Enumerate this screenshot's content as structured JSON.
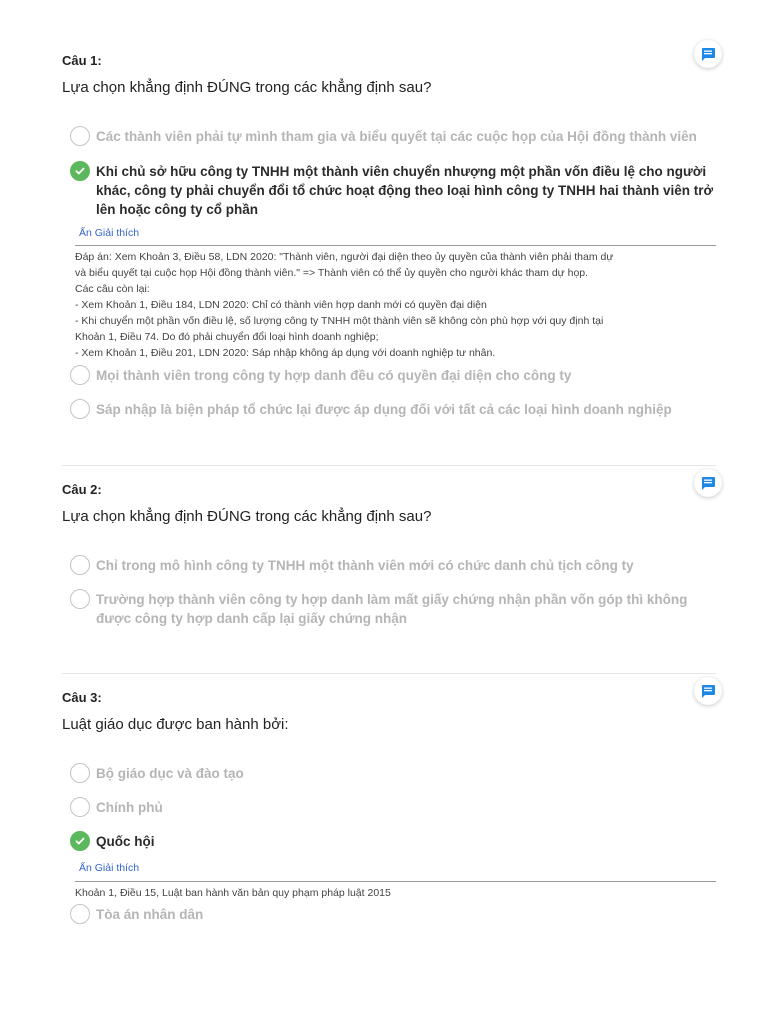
{
  "questions": [
    {
      "label": "Câu 1:",
      "title": "Lựa chọn khẳng định ĐÚNG trong các khẳng định sau?",
      "options": [
        {
          "text": "Các thành viên phải tự mình tham gia và biểu quyết tại các cuộc họp của Hội đồng thành viên",
          "checked": false
        },
        {
          "text": "Khi chủ sở hữu công ty TNHH một thành viên chuyển nhượng một phần vốn điều lệ cho người khác, công ty phải chuyển đổi tổ chức hoạt động theo loại hình công ty TNHH hai thành viên trở lên hoặc công ty cổ phần",
          "checked": true
        },
        {
          "text": "Mọi thành viên trong công ty hợp danh đều có quyền đại diện cho công ty",
          "checked": false
        },
        {
          "text": "Sáp nhập là biện pháp tổ chức lại được áp dụng đối với tất cả các loại hình doanh nghiệp",
          "checked": false
        }
      ],
      "toggle_label": "Ẩn Giải thích",
      "explanation": [
        "Đáp án: Xem Khoản 3, Điều 58, LDN 2020: \"Thành viên, người đại diện theo ủy quyền của thành viên phải tham dự",
        "và biểu quyết tại cuộc họp Hội đồng thành viên.\" => Thành viên có thể ủy quyền cho người khác tham dự họp.",
        "Các câu còn lại:",
        "- Xem Khoản 1, Điều 184, LDN 2020: Chỉ có thành viên hợp danh mới có quyền đại diện",
        "- Khi chuyển một phần vốn điều lệ, số lượng công ty TNHH một thành viên sẽ không còn phù hợp với quy định tại",
        "Khoản 1, Điều 74. Do đó phải chuyển đổi loại hình doanh nghiệp;",
        "- Xem Khoản 1, Điều 201, LDN 2020: Sáp nhập không áp dụng với doanh nghiệp tư nhân."
      ]
    },
    {
      "label": "Câu 2:",
      "title": "Lựa chọn khẳng định ĐÚNG trong các khẳng định sau?",
      "options": [
        {
          "text": "Chỉ trong mô hình công ty TNHH một thành viên mới có chức danh chủ tịch công ty",
          "checked": false
        },
        {
          "text": "Trường hợp thành viên công ty hợp danh làm mất giấy chứng nhận phần vốn góp thì không được công ty hợp danh cấp lại giấy chứng nhận",
          "checked": false
        }
      ]
    },
    {
      "label": "Câu 3:",
      "title": "Luật giáo dục được ban hành bởi:",
      "options": [
        {
          "text": "Bộ giáo dục và đào tạo",
          "checked": false
        },
        {
          "text": "Chính phủ",
          "checked": false
        },
        {
          "text": "Quốc hội",
          "checked": true
        },
        {
          "text": "Tòa án nhân dân",
          "checked": false
        }
      ],
      "toggle_label": "Ẩn Giải thích",
      "explanation": [
        "Khoản 1, Điều 15, Luật ban hành văn bản quy phạm pháp luật 2015"
      ]
    }
  ],
  "colors": {
    "accent": "#1e88e5",
    "correct": "#5cb85c",
    "link": "#3366cc",
    "muted_option": "#b5b5b5"
  },
  "icons": {
    "comment": "comment-icon",
    "check": "check-icon"
  }
}
